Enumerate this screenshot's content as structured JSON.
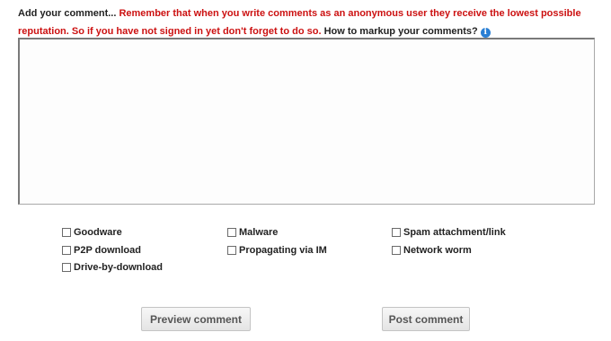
{
  "intro": {
    "lead": "Add your comment...",
    "warning": "Remember that when you write comments as an anonymous user they receive the lowest possible reputation. So if you have not signed in yet don't forget to do so.",
    "markup_link": "How to markup your comments?",
    "info_glyph": "i",
    "info_icon": "info-icon",
    "warning_color": "#cc1111"
  },
  "comment": {
    "value": "",
    "placeholder": ""
  },
  "categories": {
    "goodware": "Goodware",
    "malware": "Malware",
    "spam": "Spam attachment/link",
    "p2p": "P2P download",
    "im": "Propagating via IM",
    "worm": "Network worm",
    "driveby": "Drive-by-download"
  },
  "buttons": {
    "preview": "Preview comment",
    "post": "Post comment"
  }
}
